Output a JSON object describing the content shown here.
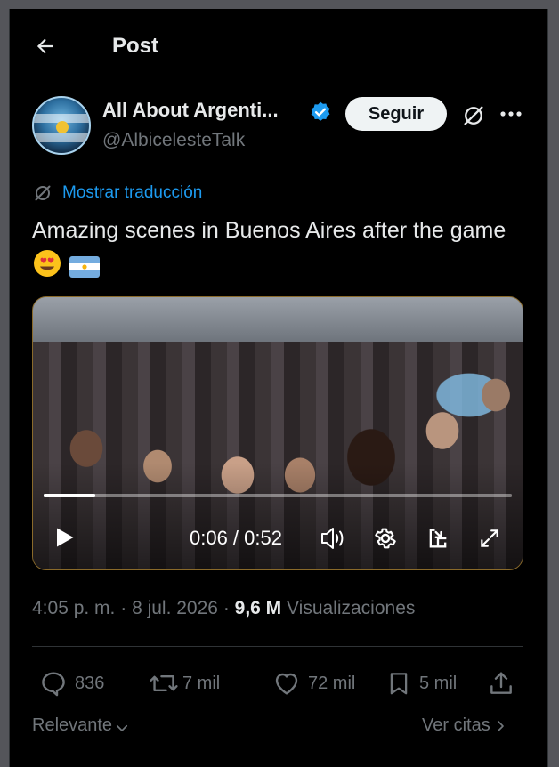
{
  "header": {
    "title": "Post"
  },
  "author": {
    "name": "All About Argenti...",
    "handle": "@AlbicelesteTalk",
    "follow_label": "Seguir"
  },
  "translate": {
    "label": "Mostrar traducción"
  },
  "tweet": {
    "text": "Amazing scenes in Buenos Aires after the game",
    "emojis": [
      "smiling-face-with-heart-eyes",
      "flag-argentina"
    ]
  },
  "video": {
    "time": "0:06 / 0:52",
    "progress": 0.11
  },
  "meta": {
    "time": "4:05 p. m.",
    "sep1": " · ",
    "date": "8 jul. 2026",
    "sep2": " · ",
    "views": "9,6 M",
    "views_label": " Visualizaciones"
  },
  "actions": {
    "replies": "836",
    "reposts": "7 mil",
    "likes": "72 mil",
    "bookmarks": "5 mil"
  },
  "footer": {
    "sort_label": "Relevante",
    "quotes_label": "Ver citas"
  },
  "colors": {
    "background": "#000000",
    "accent": "#1d9bf0",
    "text": "#e7e9ea",
    "muted": "#71767b",
    "verified": "#1d9bf0"
  }
}
